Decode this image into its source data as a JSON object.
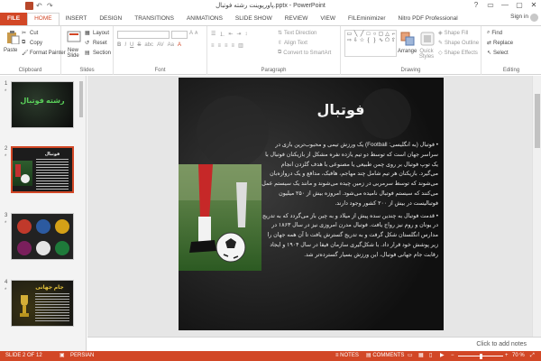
{
  "window": {
    "title": "پاورپوینت رشته فوتبال.pptx - PowerPoint",
    "controls": [
      "?",
      "▭",
      "—",
      "▢",
      "✕"
    ]
  },
  "tabs": [
    {
      "label": "FILE"
    },
    {
      "label": "HOME"
    },
    {
      "label": "INSERT"
    },
    {
      "label": "DESIGN"
    },
    {
      "label": "TRANSITIONS"
    },
    {
      "label": "ANIMATIONS"
    },
    {
      "label": "SLIDE SHOW"
    },
    {
      "label": "REVIEW"
    },
    {
      "label": "VIEW"
    },
    {
      "label": "FILEminimizer"
    },
    {
      "label": "Nitro PDF Professional"
    }
  ],
  "signin": "Sign in",
  "ribbon": {
    "clipboard": {
      "paste": "Paste",
      "cut": "Cut",
      "copy": "Copy",
      "format_painter": "Format Painter",
      "label": "Clipboard"
    },
    "slides": {
      "new_slide": "New Slide",
      "layout": "Layout",
      "reset": "Reset",
      "section": "Section",
      "label": "Slides"
    },
    "font": {
      "label": "Font"
    },
    "paragraph": {
      "text_direction": "Text Direction",
      "align_text": "Align Text",
      "convert_smartart": "Convert to SmartArt",
      "label": "Paragraph"
    },
    "drawing": {
      "arrange": "Arrange",
      "quick_styles": "Quick Styles",
      "shape_fill": "Shape Fill",
      "shape_outline": "Shape Outline",
      "shape_effects": "Shape Effects",
      "label": "Drawing"
    },
    "editing": {
      "find": "Find",
      "replace": "Replace",
      "select": "Select",
      "label": "Editing"
    }
  },
  "thumbnails": [
    {
      "number": "1",
      "star": "*",
      "title": "رشته فوتبال"
    },
    {
      "number": "2",
      "star": "*",
      "title": "فوتبال"
    },
    {
      "number": "3",
      "star": "*",
      "title": ""
    },
    {
      "number": "4",
      "star": "*",
      "title": "جام جهانی"
    }
  ],
  "slide": {
    "title": "فوتبال",
    "paragraphs": [
      "فوتبال (به انگلیسی: Football) یک ورزش تیمی و محبوب‌ترین بازی در سراسر جهان است که توسط دو تیم یازده نفره مشکل از بازیکنان فوتبال با یک توپ فوتبال بر روی چمن طبیعی یا مصنوعی با هدف گلزدن انجام می‌گیرد. بازیکنان هر تیم شامل چند مهاجم، هافبک، مدافع و یک دروازه‌بان می‌شوند که توسط سرمربی در زمین چیده می‌شوند و مانند یک سیستم عمل می‌کنند که سیستم فوتبال نامیده می‌شود. امروزه بیش از ۲۵۰ میلیون فوتبالیست در بیش از ۲۰۰ کشور وجود دارند.",
      "قدمت فوتبال به چندین سده پیش از میلاد و به چین باز می‌گردد که به تدریج در یونان و روم نیز رواج یافت. فوتبال مدرن امروزی نیز در سال ۱۸۶۳ در مدارس انگلستان شکل گرفت و به تدریج گسترش یافت تا آن همه جهان را زیر پوشش خود قرار داد. با شکل‌گیری سازمان فیفا در سال ۱۹۰۴ و ایجاد رقابت جام جهانی فوتبال، این ورزش بسیار گسترده‌تر شد."
    ]
  },
  "notes_placeholder": "Click to add notes",
  "status": {
    "slide_counter": "SLIDE 2 OF 12",
    "language": "PERSIAN",
    "notes": "NOTES",
    "comments": "COMMENTS",
    "zoom": "70 %"
  },
  "colors": {
    "accent": "#d24726",
    "slide_bg": "#1b1b1b"
  }
}
